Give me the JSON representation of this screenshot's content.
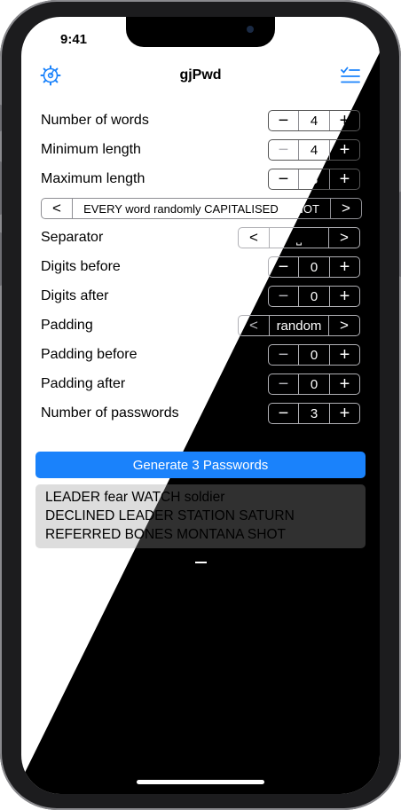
{
  "status": {
    "time": "9:41"
  },
  "nav": {
    "title": "gjPwd"
  },
  "settings": {
    "number_of_words": {
      "label": "Number of words",
      "value": "4",
      "minus": "−",
      "plus": "+"
    },
    "minimum_length": {
      "label": "Minimum length",
      "value": "4",
      "minus": "−",
      "plus": "+"
    },
    "maximum_length": {
      "label": "Maximum length",
      "value": "8",
      "minus": "−",
      "plus": "+"
    },
    "capitalisation": {
      "prev": "<",
      "value": "EVERY word randomly CAPITALISED or NOT",
      "next": ">"
    },
    "separator": {
      "label": "Separator",
      "prev": "<",
      "value": "⎵",
      "next": ">"
    },
    "digits_before": {
      "label": "Digits before",
      "value": "0",
      "minus": "−",
      "plus": "+"
    },
    "digits_after": {
      "label": "Digits after",
      "value": "0",
      "minus": "−",
      "plus": "+"
    },
    "padding": {
      "label": "Padding",
      "prev": "<",
      "value": "random",
      "next": ">"
    },
    "padding_before": {
      "label": "Padding before",
      "value": "0",
      "minus": "−",
      "plus": "+"
    },
    "padding_after": {
      "label": "Padding after",
      "value": "0",
      "minus": "−",
      "plus": "+"
    },
    "number_of_passwords": {
      "label": "Number of passwords",
      "value": "3",
      "minus": "−",
      "plus": "+"
    }
  },
  "generate_button": "Generate 3 Passwords",
  "passwords": [
    "LEADER fear WATCH soldier",
    "DECLINED LEADER STATION SATURN",
    "REFERRED BONES MONTANA SHOT"
  ],
  "colors": {
    "accent": "#1a82fb"
  },
  "icons": {
    "left": "gear-icon",
    "right": "checklist-icon"
  }
}
